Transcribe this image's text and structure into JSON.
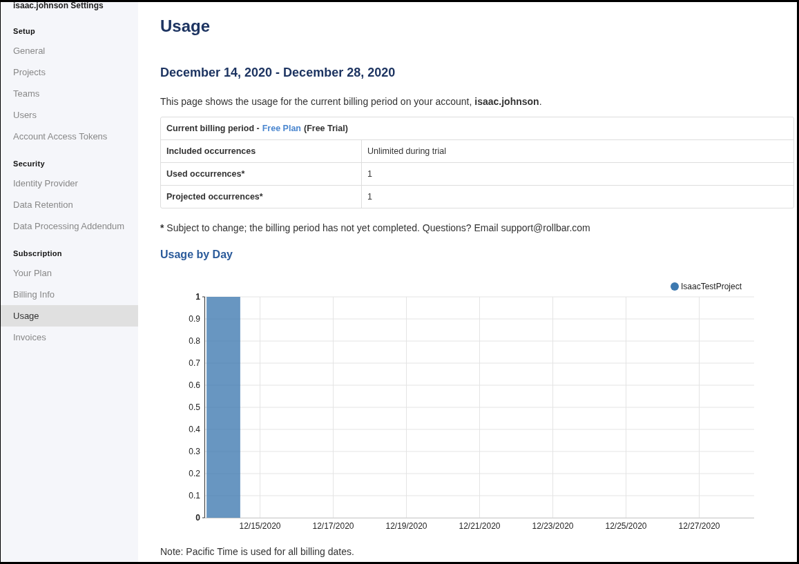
{
  "sidebar": {
    "title": "isaac.johnson Settings",
    "sections": [
      {
        "heading": "Setup",
        "items": [
          {
            "label": "General",
            "selected": false
          },
          {
            "label": "Projects",
            "selected": false
          },
          {
            "label": "Teams",
            "selected": false
          },
          {
            "label": "Users",
            "selected": false
          },
          {
            "label": "Account Access Tokens",
            "selected": false
          }
        ]
      },
      {
        "heading": "Security",
        "items": [
          {
            "label": "Identity Provider",
            "selected": false
          },
          {
            "label": "Data Retention",
            "selected": false
          },
          {
            "label": "Data Processing Addendum",
            "selected": false
          }
        ]
      },
      {
        "heading": "Subscription",
        "items": [
          {
            "label": "Your Plan",
            "selected": false
          },
          {
            "label": "Billing Info",
            "selected": false
          },
          {
            "label": "Usage",
            "selected": true
          },
          {
            "label": "Invoices",
            "selected": false
          }
        ]
      }
    ]
  },
  "page": {
    "title": "Usage",
    "period": "December 14, 2020 - December 28, 2020",
    "intro": "This page shows the usage for the current billing period on your account, **isaac.johnson**."
  },
  "billing_table": {
    "header_prefix": "Current billing period -",
    "plan_link": "Free Plan",
    "header_suffix": "(Free Trial)",
    "rows": [
      {
        "label": "Included occurrences",
        "value": "Unlimited during trial"
      },
      {
        "label": "Used occurrences*",
        "value": "1"
      },
      {
        "label": "Projected occurrences*",
        "value": "1"
      }
    ]
  },
  "footnote": {
    "mark": "*",
    "text": "Subject to change; the billing period has not yet completed. Questions? Email support@rollbar.com"
  },
  "usage_by_day": {
    "title": "Usage by Day",
    "chart_data": {
      "type": "bar",
      "categories": [
        null,
        "12/15/2020",
        null,
        "12/17/2020",
        null,
        "12/19/2020",
        null,
        "12/21/2020",
        null,
        "12/23/2020",
        null,
        "12/25/2020",
        null,
        "12/27/2020",
        null
      ],
      "grid": true,
      "series": [
        {
          "name": "IsaacTestProject",
          "color": "#3d79b0",
          "values": [
            1,
            0,
            0,
            0,
            0,
            0,
            0,
            0,
            0,
            0,
            0,
            0,
            0,
            0,
            0
          ]
        }
      ],
      "ylim": [
        0,
        1
      ],
      "yticks": [
        0,
        0.1,
        0.2,
        0.3,
        0.4,
        0.5,
        0.6,
        0.7,
        0.8,
        0.9,
        1
      ]
    }
  },
  "note": "Note: Pacific Time is used for all billing dates."
}
